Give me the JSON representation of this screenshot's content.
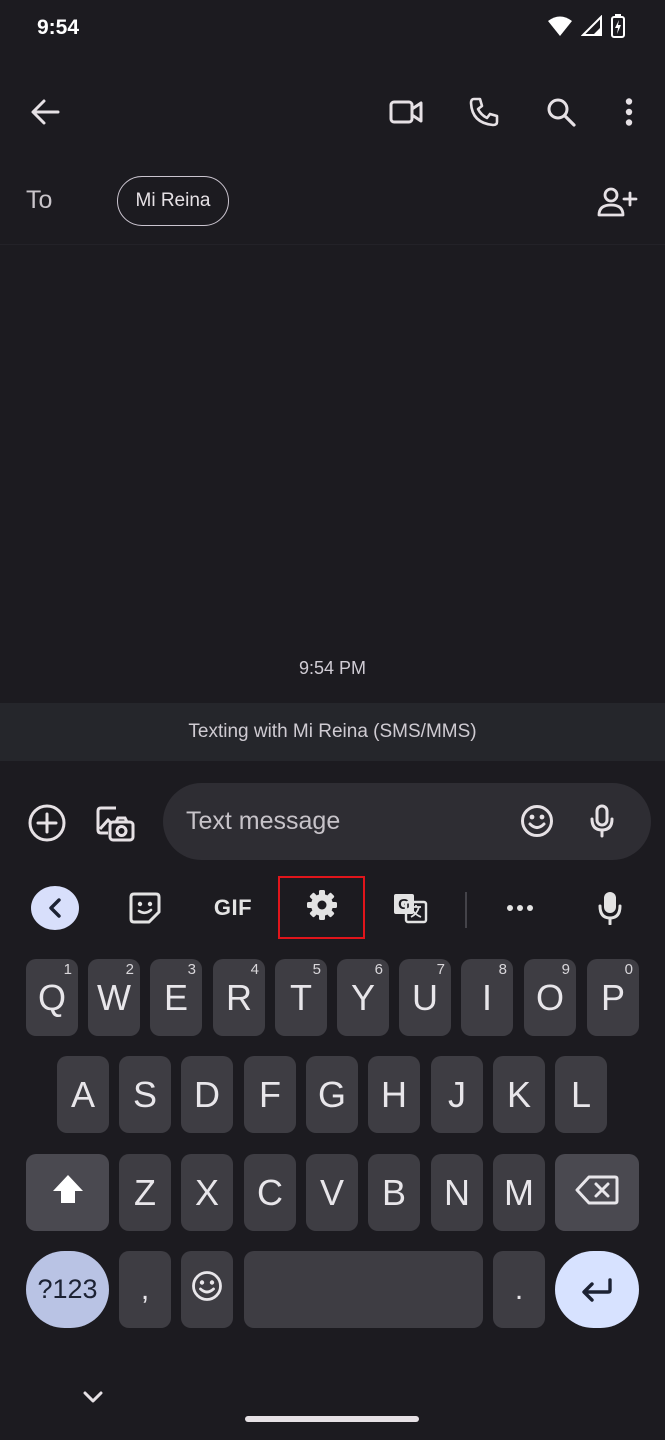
{
  "status_bar": {
    "time": "9:54",
    "icons": [
      "wifi-icon",
      "signal-icon",
      "battery-charging-icon"
    ]
  },
  "app_bar": {
    "icons": [
      "back-arrow-icon",
      "video-call-icon",
      "phone-icon",
      "search-icon",
      "more-vert-icon"
    ]
  },
  "recipient": {
    "to_label": "To",
    "chip": "Mi Reina",
    "add_icon": "add-person-icon"
  },
  "conversation": {
    "timestamp": "9:54 PM",
    "banner": "Texting with Mi Reina (SMS/MMS)"
  },
  "compose": {
    "placeholder": "Text message",
    "icons": [
      "add-circle-icon",
      "gallery-camera-icon",
      "emoji-icon",
      "mic-icon"
    ]
  },
  "keyboard_toolbar": {
    "items": [
      "back-chevron-icon",
      "sticker-icon",
      "gif",
      "settings-icon",
      "translate-icon",
      "more-horiz-icon",
      "mic-icon"
    ],
    "gif_label": "GIF",
    "highlighted": "settings-icon",
    "highlight_color": "#e0151b"
  },
  "keyboard": {
    "row1": [
      {
        "key": "Q",
        "hint": "1"
      },
      {
        "key": "W",
        "hint": "2"
      },
      {
        "key": "E",
        "hint": "3"
      },
      {
        "key": "R",
        "hint": "4"
      },
      {
        "key": "T",
        "hint": "5"
      },
      {
        "key": "Y",
        "hint": "6"
      },
      {
        "key": "U",
        "hint": "7"
      },
      {
        "key": "I",
        "hint": "8"
      },
      {
        "key": "O",
        "hint": "9"
      },
      {
        "key": "P",
        "hint": "0"
      }
    ],
    "row2": [
      "A",
      "S",
      "D",
      "F",
      "G",
      "H",
      "J",
      "K",
      "L"
    ],
    "row3": [
      "Z",
      "X",
      "C",
      "V",
      "B",
      "N",
      "M"
    ],
    "symbols_label": "?123",
    "comma": ",",
    "period": ".",
    "icons": [
      "shift-icon",
      "backspace-icon",
      "emoji-key-icon",
      "enter-icon",
      "hide-keyboard-chevron-icon"
    ]
  },
  "colors": {
    "background": "#1c1b20",
    "key": "#3e3d43",
    "accent": "#d7e2ff"
  }
}
